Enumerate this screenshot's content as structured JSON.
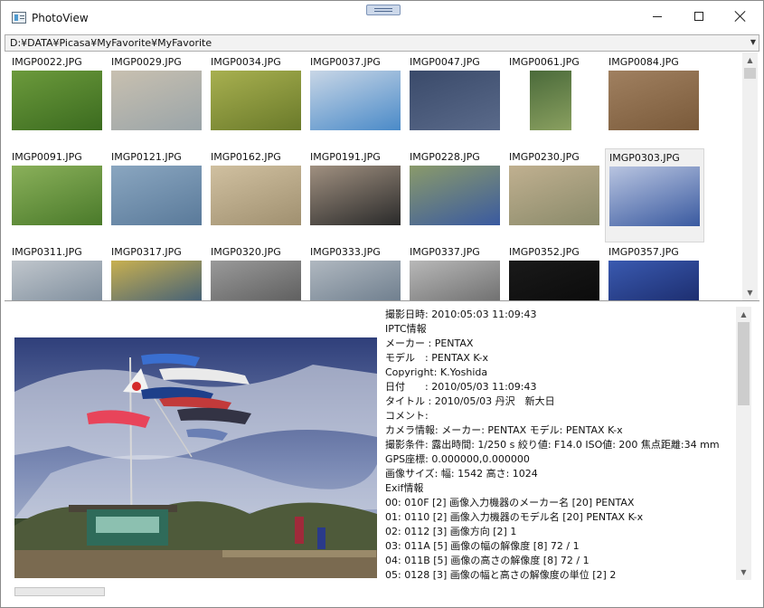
{
  "window": {
    "title": "PhotoView",
    "icon": "app-icon"
  },
  "path": {
    "value": "D:¥DATA¥Picasa¥MyFavorite¥MyFavorite"
  },
  "thumbnails": [
    {
      "label": "IMGP0022.JPG"
    },
    {
      "label": "IMGP0029.JPG"
    },
    {
      "label": "IMGP0034.JPG"
    },
    {
      "label": "IMGP0037.JPG"
    },
    {
      "label": "IMGP0047.JPG"
    },
    {
      "label": "IMGP0061.JPG"
    },
    {
      "label": "IMGP0084.JPG"
    },
    {
      "label": "IMGP0091.JPG"
    },
    {
      "label": "IMGP0121.JPG"
    },
    {
      "label": "IMGP0162.JPG"
    },
    {
      "label": "IMGP0191.JPG"
    },
    {
      "label": "IMGP0228.JPG"
    },
    {
      "label": "IMGP0230.JPG"
    },
    {
      "label": "IMGP0303.JPG",
      "selected": true
    },
    {
      "label": "IMGP0311.JPG"
    },
    {
      "label": "IMGP0317.JPG"
    },
    {
      "label": "IMGP0320.JPG"
    },
    {
      "label": "IMGP0333.JPG"
    },
    {
      "label": "IMGP0337.JPG"
    },
    {
      "label": "IMGP0352.JPG"
    },
    {
      "label": "IMGP0357.JPG"
    }
  ],
  "info_lines": [
    "撮影日時: 2010:05:03 11:09:43",
    "IPTC情報",
    "メーカー : PENTAX",
    "モデル　: PENTAX K-x",
    "Copyright: K.Yoshida",
    "日付　　: 2010/05/03 11:09:43",
    "タイトル : 2010/05/03 丹沢　新大日",
    "コメント:",
    "カメラ情報: メーカー: PENTAX モデル: PENTAX K-x",
    "撮影条件: 露出時間: 1/250 s 絞り値: F14.0 ISO値: 200 焦点距離:34 mm",
    "GPS座標: 0.000000,0.000000",
    "画像サイズ: 幅: 1542 高さ: 1024",
    "Exif情報",
    "00: 010F [2] 画像入力機器のメーカー名 [20] PENTAX",
    "01: 0110 [2] 画像入力機器のモデル名 [20] PENTAX K-x",
    "02: 0112 [3] 画像方向 [2] 1",
    "03: 011A [5] 画像の幅の解像度 [8] 72 / 1",
    "04: 011B [5] 画像の高さの解像度 [8] 72 / 1",
    "05: 0128 [3] 画像の幅と高さの解像度の単位 [2] 2"
  ],
  "colors": {
    "selected_bg": "#f0f0f0",
    "scrollbar": "#cdcdcd"
  }
}
